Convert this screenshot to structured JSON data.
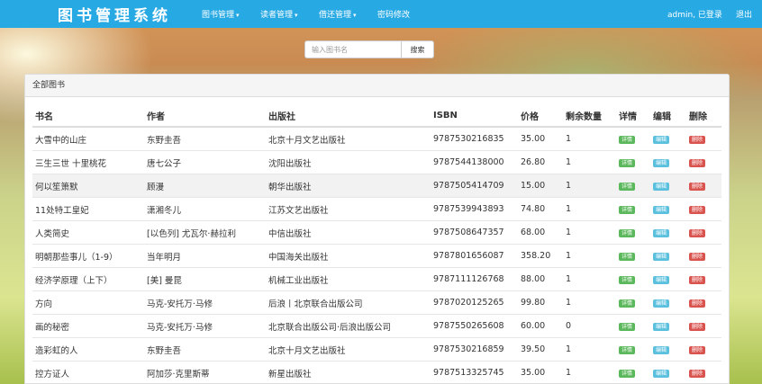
{
  "navbar": {
    "brand": "图书管理系统",
    "menu": [
      {
        "label": "图书管理",
        "dropdown": true
      },
      {
        "label": "读者管理",
        "dropdown": true
      },
      {
        "label": "借还管理",
        "dropdown": true
      },
      {
        "label": "密码修改",
        "dropdown": false
      }
    ],
    "user_status": "admin, 已登录",
    "logout": "退出"
  },
  "search": {
    "placeholder": "输入图书名",
    "button": "搜索"
  },
  "panel": {
    "title": "全部图书"
  },
  "table": {
    "columns": [
      "书名",
      "作者",
      "出版社",
      "ISBN",
      "价格",
      "剩余数量",
      "详情",
      "编辑",
      "删除"
    ],
    "action_labels": {
      "detail": "详情",
      "edit": "编辑",
      "delete": "删除"
    },
    "rows": [
      [
        "大雪中的山庄",
        "东野圭吾",
        "北京十月文艺出版社",
        "9787530216835",
        "35.00",
        "1"
      ],
      [
        "三生三世 十里桃花",
        "唐七公子",
        "沈阳出版社",
        "9787544138000",
        "26.80",
        "1"
      ],
      [
        "何以笙箫默",
        "顾漫",
        "朝华出版社",
        "9787505414709",
        "15.00",
        "1"
      ],
      [
        "11处特工皇妃",
        "潇湘冬儿",
        "江苏文艺出版社",
        "9787539943893",
        "74.80",
        "1"
      ],
      [
        "人类简史",
        "[以色列] 尤瓦尔·赫拉利",
        "中信出版社",
        "9787508647357",
        "68.00",
        "1"
      ],
      [
        "明朝那些事儿（1-9）",
        "当年明月",
        "中国海关出版社",
        "9787801656087",
        "358.20",
        "1"
      ],
      [
        "经济学原理（上下）",
        "[美] 曼昆",
        "机械工业出版社",
        "9787111126768",
        "88.00",
        "1"
      ],
      [
        "方向",
        "马克-安托万·马修",
        "后浪丨北京联合出版公司",
        "9787020125265",
        "99.80",
        "1"
      ],
      [
        "画的秘密",
        "马克-安托万·马修",
        "北京联合出版公司·后浪出版公司",
        "9787550265608",
        "60.00",
        "0"
      ],
      [
        "造彩虹的人",
        "东野圭吾",
        "北京十月文艺出版社",
        "9787530216859",
        "39.50",
        "1"
      ],
      [
        "控方证人",
        "阿加莎·克里斯蒂",
        "新星出版社",
        "9787513325745",
        "35.00",
        "1"
      ]
    ]
  },
  "colors": {
    "navbar": "#27a9e3",
    "detail": "#5cb85c",
    "edit": "#5bc0de",
    "delete": "#d9534f"
  }
}
